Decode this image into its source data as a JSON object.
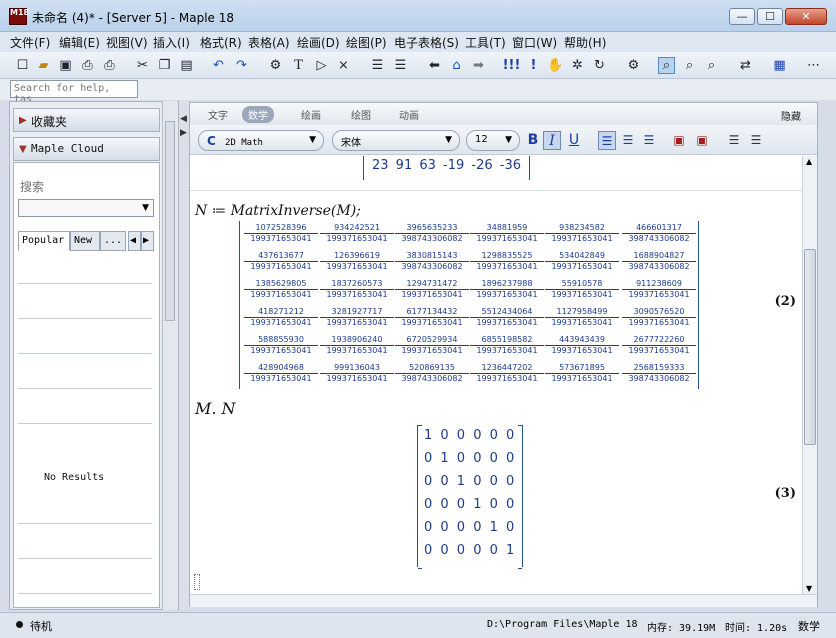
{
  "window": {
    "title": "未命名 (4)* - [Server 5] - Maple 18",
    "app_icon_text": "M18",
    "minimize": "—",
    "maximize": "☐",
    "close": "✕"
  },
  "menu": [
    "文件(F)",
    "编辑(E)",
    "视图(V)",
    "插入(I)",
    "格式(R)",
    "表格(A)",
    "绘画(D)",
    "绘图(P)",
    "电子表格(S)",
    "工具(T)",
    "窗口(W)",
    "帮助(H)"
  ],
  "help_search": {
    "placeholder": "Search for help, tas"
  },
  "left_panel": {
    "favorites_label": "收藏夹",
    "cloud_label": "Maple Cloud",
    "search_label": "搜索",
    "tabs": [
      "Popular",
      "New",
      "..."
    ],
    "no_results": "No Results"
  },
  "context_tabs": [
    "文字",
    "数学",
    "绘画",
    "绘图",
    "动画"
  ],
  "context_active": "数学",
  "hide_label": "隐藏",
  "format_bar": {
    "math_mode": "2D Math",
    "math_mode_letter": "C",
    "font": "宋体",
    "size": "12",
    "bold": "B",
    "italic": "I",
    "underline": "U"
  },
  "document": {
    "prev_row": "23   91   63  -19  -26  -36",
    "command1": "N ≔ MatrixInverse(M);",
    "matrix_rows": [
      [
        [
          "1072528396",
          "199371653041"
        ],
        [
          "934242521",
          "199371653041"
        ],
        [
          "3965635233",
          "398743306082"
        ],
        [
          "34881959",
          "199371653041"
        ],
        [
          "938234582",
          "199371653041"
        ],
        [
          "466601317",
          "398743306082"
        ]
      ],
      [
        [
          "437613677",
          "199371653041"
        ],
        [
          "126396619",
          "199371653041"
        ],
        [
          "3830815143",
          "398743306082"
        ],
        [
          "1298835525",
          "199371653041"
        ],
        [
          "534042849",
          "199371653041"
        ],
        [
          "1688904827",
          "398743306082"
        ]
      ],
      [
        [
          "1385629805",
          "199371653041"
        ],
        [
          "1837260573",
          "199371653041"
        ],
        [
          "1294731472",
          "199371653041"
        ],
        [
          "1896237988",
          "199371653041"
        ],
        [
          "55910578",
          "199371653041"
        ],
        [
          "911238609",
          "199371653041"
        ]
      ],
      [
        [
          "418271212",
          "199371653041"
        ],
        [
          "3281927717",
          "199371653041"
        ],
        [
          "6177134432",
          "199371653041"
        ],
        [
          "5512434064",
          "199371653041"
        ],
        [
          "1127958499",
          "199371653041"
        ],
        [
          "3090576520",
          "199371653041"
        ]
      ],
      [
        [
          "588855930",
          "199371653041"
        ],
        [
          "1938906240",
          "199371653041"
        ],
        [
          "6720529934",
          "199371653041"
        ],
        [
          "6855198582",
          "199371653041"
        ],
        [
          "443943439",
          "199371653041"
        ],
        [
          "2677722260",
          "199371653041"
        ]
      ],
      [
        [
          "428904968",
          "199371653041"
        ],
        [
          "999136043",
          "199371653041"
        ],
        [
          "520869135",
          "398743306082"
        ],
        [
          "1236447202",
          "199371653041"
        ],
        [
          "573671895",
          "199371653041"
        ],
        [
          "2568159333",
          "398743306082"
        ]
      ]
    ],
    "label2": "(2)",
    "command2": "M. N",
    "identity_rows": [
      "1 0 0 0 0 0",
      "0 1 0 0 0 0",
      "0 0 1 0 0 0",
      "0 0 0 1 0 0",
      "0 0 0 0 1 0",
      "0 0 0 0 0 1"
    ],
    "label3": "(3)"
  },
  "status": {
    "state": "待机",
    "path": "D:\\Program Files\\Maple 18",
    "memory": "内存: 39.19M",
    "time": "时间: 1.20s",
    "mode": "数学"
  }
}
